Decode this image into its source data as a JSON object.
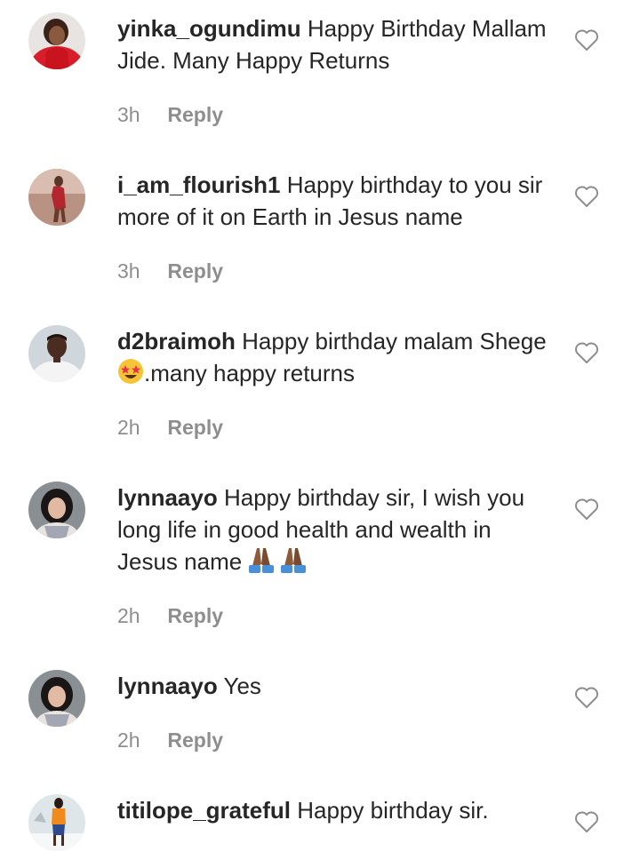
{
  "comments": [
    {
      "username": "yinka_ogundimu",
      "text": "Happy Birthday Mallam Jide. Many Happy Returns",
      "time": "3h",
      "reply": "Reply",
      "avatar": "avatar-woman-red",
      "like_icon": "heart-outline-icon"
    },
    {
      "username": "i_am_flourish1",
      "text": "Happy birthday to you sir more of it on Earth in Jesus name",
      "time": "3h",
      "reply": "Reply",
      "avatar": "avatar-woman-red-dress",
      "like_icon": "heart-outline-icon"
    },
    {
      "username": "d2braimoh",
      "text_before_emoji": "Happy birthday malam Shege",
      "emoji": "star-struck-emoji",
      "text_after_emoji": ".many happy returns",
      "time": "2h",
      "reply": "Reply",
      "avatar": "avatar-man-white",
      "like_icon": "heart-outline-icon"
    },
    {
      "username": "lynnaayo",
      "text": "Happy birthday sir, I wish you long life in good health and wealth in Jesus name",
      "emoji": "folded-hands-emoji",
      "time": "2h",
      "reply": "Reply",
      "avatar": "avatar-woman-selfie",
      "like_icon": "heart-outline-icon"
    },
    {
      "username": "lynnaayo",
      "text": "Yes",
      "time": "2h",
      "reply": "Reply",
      "avatar": "avatar-woman-selfie",
      "like_icon": "heart-outline-icon"
    },
    {
      "username": "titilope_grateful",
      "text": "Happy birthday sir.",
      "avatar": "avatar-person-snow",
      "like_icon": "heart-outline-icon"
    }
  ],
  "colors": {
    "text": "#262626",
    "meta": "#8e8e8e",
    "background": "#ffffff"
  }
}
